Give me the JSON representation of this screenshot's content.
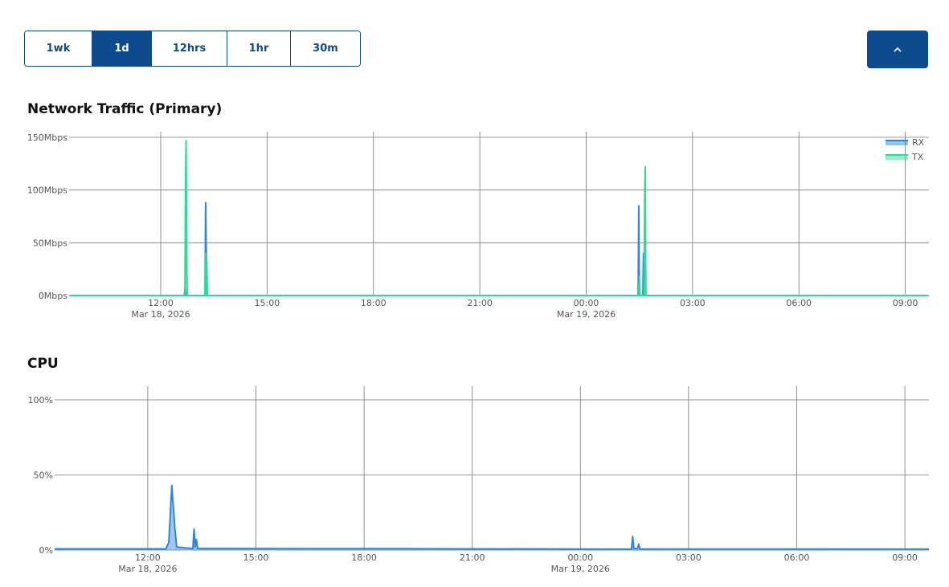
{
  "toolbar": {
    "ranges": [
      "1wk",
      "1d",
      "12hrs",
      "1hr",
      "30m"
    ],
    "active_range": "1d",
    "collapse_icon": "chevron-up-icon"
  },
  "colors": {
    "primary": "#0d4b8c",
    "rx": "#2e86de",
    "tx": "#2bdc97",
    "cpu": "#2e86de",
    "grid": "#777777"
  },
  "network": {
    "title": "Network Traffic (Primary)"
  },
  "cpu": {
    "title": "CPU"
  },
  "chart_data": [
    {
      "type": "area",
      "title": "Network Traffic (Primary)",
      "xlabel": "",
      "ylabel": "",
      "y_unit": "Mbps",
      "xlim": [
        "Mar 18, 2026 09:25",
        "Mar 19, 2026 09:40"
      ],
      "ylim": [
        0,
        150
      ],
      "y_ticks": [
        "150Mbps",
        "100Mbps",
        "50Mbps",
        "0Mbps"
      ],
      "y_tick_values": [
        150,
        100,
        50,
        0
      ],
      "x_ticks": [
        {
          "time": "Mar 18, 2026 12:00",
          "label": "12:00",
          "sub": "Mar 18, 2026"
        },
        {
          "time": "Mar 18, 2026 15:00",
          "label": "15:00",
          "sub": ""
        },
        {
          "time": "Mar 18, 2026 18:00",
          "label": "18:00",
          "sub": ""
        },
        {
          "time": "Mar 18, 2026 21:00",
          "label": "21:00",
          "sub": ""
        },
        {
          "time": "Mar 19, 2026 00:00",
          "label": "00:00",
          "sub": "Mar 19, 2026"
        },
        {
          "time": "Mar 19, 2026 03:00",
          "label": "03:00",
          "sub": ""
        },
        {
          "time": "Mar 19, 2026 06:00",
          "label": "06:00",
          "sub": ""
        },
        {
          "time": "Mar 19, 2026 09:00",
          "label": "09:00",
          "sub": ""
        }
      ],
      "grid": true,
      "legend_position": "top-right",
      "series": [
        {
          "name": "RX",
          "points": [
            [
              "Mar 18, 2026 09:25",
              0
            ],
            [
              "Mar 18, 2026 12:40",
              0
            ],
            [
              "Mar 18, 2026 12:41",
              7
            ],
            [
              "Mar 18, 2026 12:42",
              0
            ],
            [
              "Mar 18, 2026 12:43",
              3
            ],
            [
              "Mar 18, 2026 12:44",
              0
            ],
            [
              "Mar 18, 2026 13:15",
              0
            ],
            [
              "Mar 18, 2026 13:16",
              88
            ],
            [
              "Mar 18, 2026 13:17",
              45
            ],
            [
              "Mar 18, 2026 13:18",
              0
            ],
            [
              "Mar 19, 2026 01:28",
              0
            ],
            [
              "Mar 19, 2026 01:29",
              85
            ],
            [
              "Mar 19, 2026 01:30",
              0
            ],
            [
              "Mar 19, 2026 01:36",
              0
            ],
            [
              "Mar 19, 2026 01:37",
              40
            ],
            [
              "Mar 19, 2026 01:38",
              0
            ],
            [
              "Mar 19, 2026 09:40",
              0
            ]
          ]
        },
        {
          "name": "TX",
          "points": [
            [
              "Mar 18, 2026 09:25",
              0
            ],
            [
              "Mar 18, 2026 12:41",
              0
            ],
            [
              "Mar 18, 2026 12:42",
              105
            ],
            [
              "Mar 18, 2026 12:43",
              147
            ],
            [
              "Mar 18, 2026 12:44",
              28
            ],
            [
              "Mar 18, 2026 12:45",
              0
            ],
            [
              "Mar 18, 2026 13:15",
              0
            ],
            [
              "Mar 18, 2026 13:16",
              40
            ],
            [
              "Mar 18, 2026 13:17",
              0
            ],
            [
              "Mar 18, 2026 13:18",
              32
            ],
            [
              "Mar 18, 2026 13:19",
              0
            ],
            [
              "Mar 19, 2026 01:29",
              0
            ],
            [
              "Mar 19, 2026 01:30",
              18
            ],
            [
              "Mar 19, 2026 01:31",
              0
            ],
            [
              "Mar 19, 2026 01:38",
              0
            ],
            [
              "Mar 19, 2026 01:39",
              90
            ],
            [
              "Mar 19, 2026 01:40",
              122
            ],
            [
              "Mar 19, 2026 01:41",
              0
            ],
            [
              "Mar 19, 2026 09:40",
              0
            ]
          ]
        }
      ]
    },
    {
      "type": "area",
      "title": "CPU",
      "xlabel": "",
      "ylabel": "",
      "y_unit": "%",
      "xlim": [
        "Mar 18, 2026 09:25",
        "Mar 19, 2026 09:40"
      ],
      "ylim": [
        0,
        100
      ],
      "y_ticks": [
        "100%",
        "50%",
        "0%"
      ],
      "y_tick_values": [
        100,
        50,
        0
      ],
      "x_ticks": [
        {
          "time": "Mar 18, 2026 12:00",
          "label": "12:00",
          "sub": "Mar 18, 2026"
        },
        {
          "time": "Mar 18, 2026 15:00",
          "label": "15:00",
          "sub": ""
        },
        {
          "time": "Mar 18, 2026 18:00",
          "label": "18:00",
          "sub": ""
        },
        {
          "time": "Mar 18, 2026 21:00",
          "label": "21:00",
          "sub": ""
        },
        {
          "time": "Mar 19, 2026 00:00",
          "label": "00:00",
          "sub": "Mar 19, 2026"
        },
        {
          "time": "Mar 19, 2026 03:00",
          "label": "03:00",
          "sub": ""
        },
        {
          "time": "Mar 19, 2026 06:00",
          "label": "06:00",
          "sub": ""
        },
        {
          "time": "Mar 19, 2026 09:00",
          "label": "09:00",
          "sub": ""
        }
      ],
      "grid": true,
      "legend_position": "none",
      "series": [
        {
          "points": [
            [
              "Mar 18, 2026 09:25",
              0.8
            ],
            [
              "Mar 18, 2026 12:30",
              0.8
            ],
            [
              "Mar 18, 2026 12:35",
              5
            ],
            [
              "Mar 18, 2026 12:40",
              43
            ],
            [
              "Mar 18, 2026 12:45",
              15
            ],
            [
              "Mar 18, 2026 12:48",
              2
            ],
            [
              "Mar 18, 2026 13:15",
              1
            ],
            [
              "Mar 18, 2026 13:17",
              14
            ],
            [
              "Mar 18, 2026 13:19",
              2
            ],
            [
              "Mar 18, 2026 13:21",
              7
            ],
            [
              "Mar 18, 2026 13:23",
              1
            ],
            [
              "Mar 18, 2026 19:30",
              0.9
            ],
            [
              "Mar 19, 2026 01:25",
              0.6
            ],
            [
              "Mar 19, 2026 01:27",
              9
            ],
            [
              "Mar 19, 2026 01:29",
              1
            ],
            [
              "Mar 19, 2026 01:35",
              1
            ],
            [
              "Mar 19, 2026 01:37",
              4
            ],
            [
              "Mar 19, 2026 01:39",
              0.7
            ],
            [
              "Mar 19, 2026 09:40",
              0.6
            ]
          ]
        }
      ]
    }
  ]
}
